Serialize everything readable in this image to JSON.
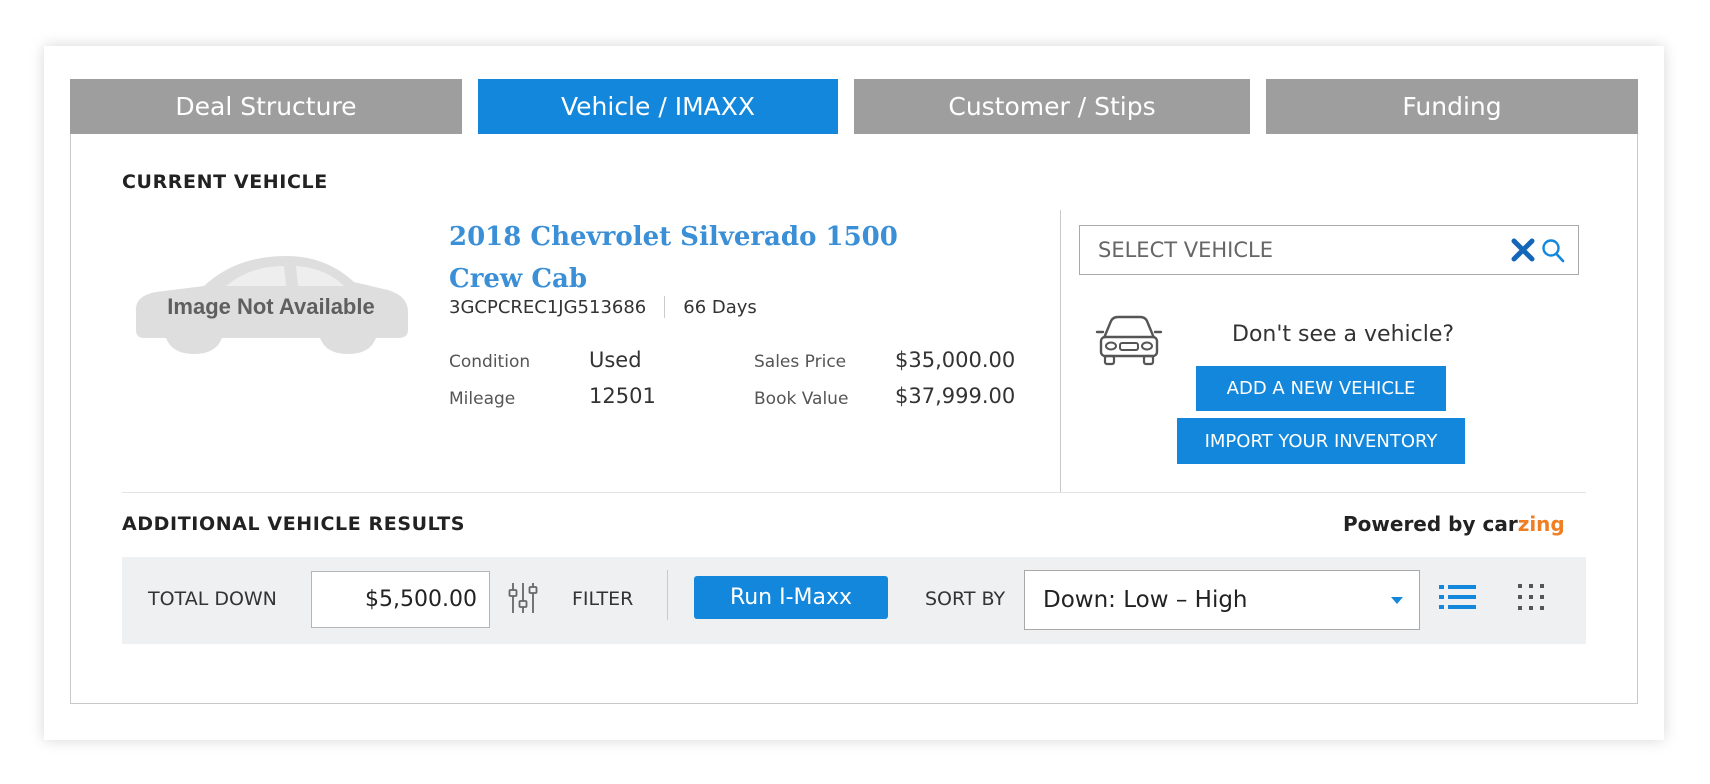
{
  "tabs": [
    {
      "label": "Deal Structure",
      "active": false
    },
    {
      "label": "Vehicle / IMAXX",
      "active": true
    },
    {
      "label": "Customer / Stips",
      "active": false
    },
    {
      "label": "Funding",
      "active": false
    }
  ],
  "current_vehicle": {
    "section_title": "CURRENT VEHICLE",
    "image_placeholder": "Image Not Available",
    "title_line1": "2018 Chevrolet Silverado 1500",
    "title_line2": "Crew Cab",
    "vin": "3GCPCREC1JG513686",
    "days": "66 Days",
    "condition_label": "Condition",
    "condition_value": "Used",
    "mileage_label": "Mileage",
    "mileage_value": "12501",
    "sales_price_label": "Sales Price",
    "sales_price_value": "$35,000.00",
    "book_value_label": "Book Value",
    "book_value_value": "$37,999.00"
  },
  "select_vehicle": {
    "placeholder": "SELECT VEHICLE",
    "prompt": "Don't see a vehicle?",
    "add_button": "ADD A NEW VEHICLE",
    "import_button": "IMPORT YOUR INVENTORY"
  },
  "additional": {
    "section_title": "ADDITIONAL VEHICLE RESULTS",
    "powered_by": "Powered by",
    "brand_part1": "car",
    "brand_part2": "zing"
  },
  "toolbar": {
    "total_down_label": "TOTAL DOWN",
    "total_down_value": "$5,500.00",
    "filter_label": "FILTER",
    "run_button": "Run I-Maxx",
    "sort_by_label": "SORT BY",
    "sort_value": "Down: Low – High"
  },
  "colors": {
    "accent": "#1387dc",
    "tab_inactive": "#9e9e9e",
    "vehicle_title": "#3a8fd6",
    "brand_orange": "#f07e22",
    "toolbar_bg": "#eef0f1"
  },
  "icons": [
    "car-placeholder-icon",
    "clear-x-icon",
    "search-icon",
    "car-front-icon",
    "filter-sliders-icon",
    "list-view-icon",
    "grid-view-icon",
    "dropdown-caret-icon"
  ]
}
